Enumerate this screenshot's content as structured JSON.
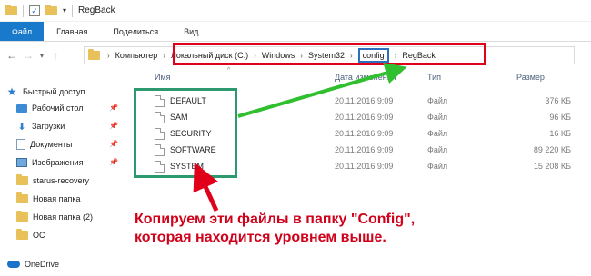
{
  "titlebar": {
    "title": "RegBack",
    "check_glyph": "✓",
    "dropdown_glyph": "▾"
  },
  "ribbon": {
    "tabs": [
      "Файл",
      "Главная",
      "Поделиться",
      "Вид"
    ]
  },
  "nav": {
    "back_glyph": "←",
    "forward_glyph": "→",
    "recent_glyph": "▾",
    "up_glyph": "↑",
    "breadcrumb": [
      "Компьютер",
      "Локальный диск (C:)",
      "Windows",
      "System32",
      "config",
      "RegBack"
    ],
    "chevron_glyph": "›"
  },
  "sidebar": {
    "quick_access": "Быстрый доступ",
    "items": [
      "Рабочий стол",
      "Загрузки",
      "Документы",
      "Изображения",
      "starus-recovery",
      "Новая папка",
      "Новая папка (2)",
      "ОС"
    ],
    "onedrive": "OneDrive",
    "pin_glyph": "📌"
  },
  "columns": {
    "name": "Имя",
    "date": "Дата изменения",
    "type": "Тип",
    "size": "Размер"
  },
  "files": [
    {
      "name": "DEFAULT",
      "date": "20.11.2016 9:09",
      "type": "Файл",
      "size": "376 КБ"
    },
    {
      "name": "SAM",
      "date": "20.11.2016 9:09",
      "type": "Файл",
      "size": "96 КБ"
    },
    {
      "name": "SECURITY",
      "date": "20.11.2016 9:09",
      "type": "Файл",
      "size": "16 КБ"
    },
    {
      "name": "SOFTWARE",
      "date": "20.11.2016 9:09",
      "type": "Файл",
      "size": "89 220 КБ"
    },
    {
      "name": "SYSTEM",
      "date": "20.11.2016 9:09",
      "type": "Файл",
      "size": "15 208 КБ"
    }
  ],
  "annotation": {
    "line1": "Копируем эти файлы в папку \"Config\",",
    "line2": "которая находится уровнем выше."
  },
  "colors": {
    "ribbon_file_tab": "#1979ca",
    "address_highlight": "#e1001a",
    "config_highlight": "#2d6fbf",
    "files_box": "#2c9a6e",
    "arrow_green": "#2fbf2f",
    "arrow_red": "#e1001a",
    "caption": "#d0021b"
  }
}
